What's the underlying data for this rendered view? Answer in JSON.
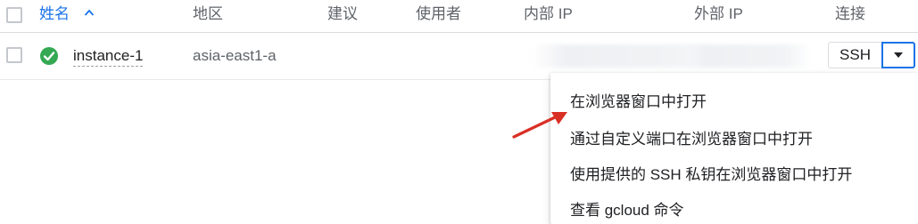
{
  "table": {
    "columns": {
      "name": "姓名",
      "zone": "地区",
      "recommendation": "建议",
      "in_use_by": "使用者",
      "internal_ip": "内部 IP",
      "external_ip": "外部 IP",
      "connect": "连接"
    },
    "sort": {
      "column": "name",
      "direction": "ascending"
    },
    "rows": [
      {
        "status": "running",
        "name": "instance-1",
        "zone": "asia-east1-a",
        "internal_ip": "",
        "external_ip": "",
        "connect_label": "SSH"
      }
    ]
  },
  "ssh_menu": {
    "items": [
      "在浏览器窗口中打开",
      "通过自定义端口在浏览器窗口中打开",
      "使用提供的 SSH 私钥在浏览器窗口中打开",
      "查看 gcloud 命令"
    ]
  },
  "colors": {
    "accent": "#1a73e8",
    "status_ok": "#34a853",
    "annotation_arrow": "#d93025"
  },
  "icons": {
    "sort": "arrow-up-icon",
    "status": "check-circle-icon",
    "dropdown": "caret-down-icon",
    "annotation": "red-arrow-icon"
  }
}
